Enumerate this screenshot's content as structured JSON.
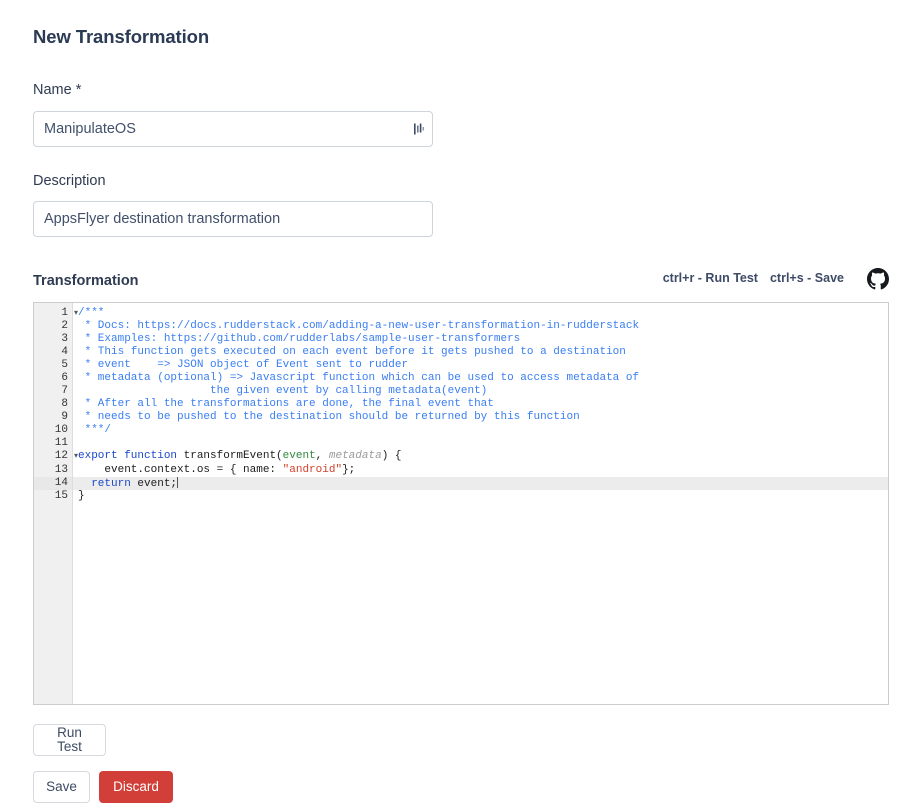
{
  "page": {
    "title": "New Transformation"
  },
  "name_field": {
    "label": "Name *",
    "value": "ManipulateOS",
    "placeholder": "",
    "icon": "resize-handle-icon"
  },
  "description_field": {
    "label": "Description",
    "value": "AppsFlyer destination transformation",
    "placeholder": ""
  },
  "transformation": {
    "label": "Transformation",
    "shortcuts": [
      "ctrl+r - Run Test",
      "ctrl+s - Save"
    ],
    "github_icon": "github-icon",
    "active_line": 14,
    "fold_lines": [
      1,
      12
    ],
    "line_numbers": [
      1,
      2,
      3,
      4,
      5,
      6,
      7,
      8,
      9,
      10,
      11,
      12,
      13,
      14,
      15
    ],
    "code_lines": [
      "/***",
      " * Docs: https://docs.rudderstack.com/adding-a-new-user-transformation-in-rudderstack",
      " * Examples: https://github.com/rudderlabs/sample-user-transformers",
      " * This function gets executed on each event before it gets pushed to a destination",
      " * event    => JSON object of Event sent to rudder",
      " * metadata (optional) => Javascript function which can be used to access metadata of",
      "                    the given event by calling metadata(event)",
      " * After all the transformations are done, the final event that",
      " * needs to be pushed to the destination should be returned by this function",
      " ***/",
      "",
      "export function transformEvent(event, metadata) {",
      "    event.context.os = { name: \"android\"};",
      "  return event;",
      "}"
    ]
  },
  "actions": {
    "run_test_label": "Run Test",
    "save_label": "Save",
    "discard_label": "Discard"
  },
  "colors": {
    "heading": "#2b3a55",
    "comment": "#3a7ef2",
    "keyword": "#1a48c9",
    "string": "#d1402a",
    "param": "#2f8a3e",
    "danger": "#d13f38",
    "input_border": "#ced4da",
    "editor_border": "#cccccc",
    "gutter_bg": "#f0f0f0"
  }
}
